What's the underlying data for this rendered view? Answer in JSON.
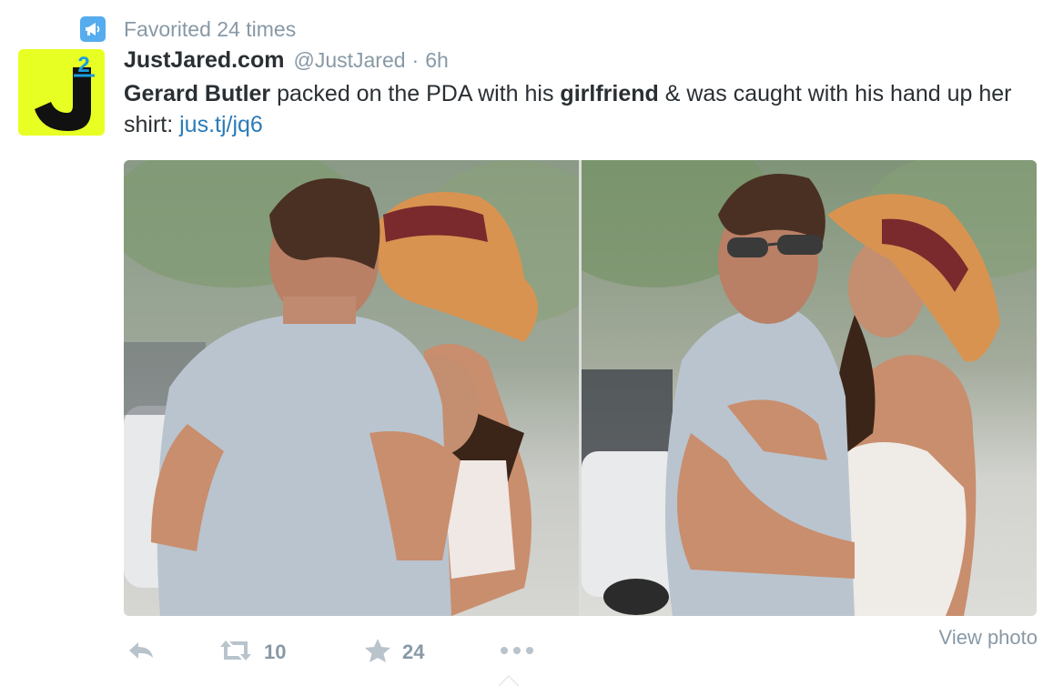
{
  "context": {
    "text": "Favorited 24 times",
    "icon": "megaphone-icon"
  },
  "author": {
    "fullname": "JustJared.com",
    "screenname": "@JustJared",
    "separator": "·",
    "time": "6h",
    "avatar": {
      "letter": "J",
      "superscript": "2",
      "background": "#e8ff24"
    }
  },
  "tweet": {
    "segments": [
      {
        "text": "Gerard Butler",
        "bold": true
      },
      {
        "text": " packed on the PDA with his ",
        "bold": false
      },
      {
        "text": "girlfriend",
        "bold": true
      },
      {
        "text": " & was caught with his hand up her shirt: ",
        "bold": false
      }
    ],
    "link": "jus.tj/jq6"
  },
  "actions": {
    "reply_icon": "reply-icon",
    "retweet_icon": "retweet-icon",
    "retweet_count": "10",
    "favorite_icon": "star-icon",
    "favorite_count": "24",
    "more_icon": "more-icon",
    "view_photo": "View photo"
  },
  "colors": {
    "link": "#2b7bb9",
    "muted": "#8899a6",
    "text": "#292f33",
    "accent": "#55acee"
  }
}
